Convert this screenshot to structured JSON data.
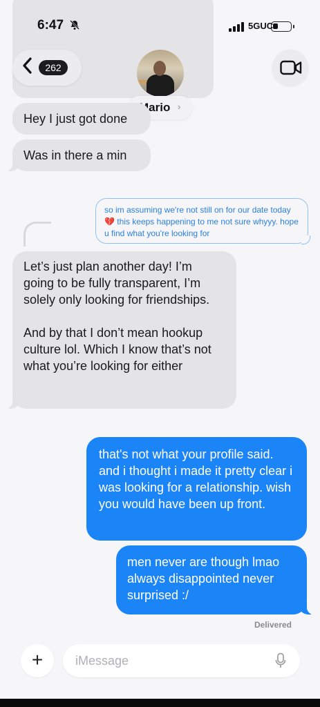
{
  "status": {
    "time": "6:47",
    "mute_icon": "bell-slash-icon",
    "network": "5GUC"
  },
  "header": {
    "back_count": "262",
    "contact_name": "Mario",
    "name_chevron": "›",
    "video_icon": "video-camera-icon"
  },
  "messages": [
    {
      "direction": "in",
      "text": "Hey I just got done"
    },
    {
      "direction": "in",
      "text": "Was in there a min"
    },
    {
      "direction": "quote",
      "text": "so im assuming we're not still on for our date today 💔 this keeps happening to me not sure whyyy. hope u find what you're looking for"
    },
    {
      "direction": "in",
      "text": "Let’s just plan another day! I’m going to be fully transparent, I’m solely only looking for friendships.\n\nAnd by that I don’t mean hookup culture lol. Which I know that’s not what you’re looking for either"
    },
    {
      "direction": "out",
      "text": "that's not what your profile said. and i thought i made it pretty clear i was looking for a relationship. wish you would have been up front."
    },
    {
      "direction": "out",
      "text": "men never are though lmao always disappointed never surprised :/"
    }
  ],
  "delivery_status": "Delivered",
  "composer": {
    "plus_label": "+",
    "placeholder": "iMessage"
  },
  "colors": {
    "outgoing_bubble": "#1b84f7",
    "incoming_bubble": "#e4e4e7",
    "background": "#f6f6f8"
  }
}
